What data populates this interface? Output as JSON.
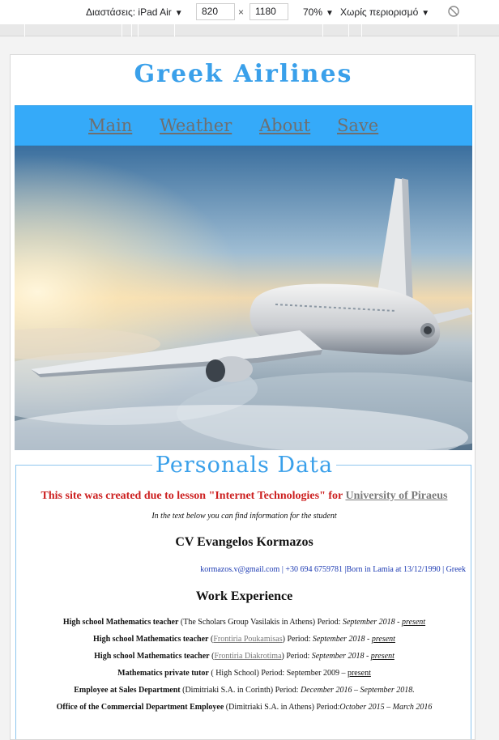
{
  "devtools": {
    "dimensions_label": "Διαστάσεις: iPad Air",
    "width": "820",
    "times": "×",
    "height": "1180",
    "zoom": "70%",
    "throttle": "Χωρίς περιορισμό"
  },
  "site": {
    "title": "Greek Airlines",
    "nav": [
      "Main",
      "Weather",
      "About",
      "Save"
    ]
  },
  "personals": {
    "heading": "Personals Data",
    "notice_text": "This site was created due to lesson \"Internet Technologies\" for ",
    "notice_link": "University of Piraeus",
    "intro": "In the text below you can find information for the student",
    "cv_title": "CV Evangelos Kormazos",
    "contact": "kormazos.v@gmail.com | +30 694 6759781 |Born in Lamia at 13/12/1990 | Greek",
    "work_title": "Work Experience",
    "jobs": [
      {
        "role": "High school Mathematics teacher",
        "pre": " (The Scholars Group Vasilakis in Athens) Period: ",
        "link": "",
        "post": "",
        "period": "September 2018 - ",
        "present": "present"
      },
      {
        "role": "High school Mathematics teacher",
        "pre": " (",
        "link": "Frontiria Poukamisas",
        "post": ") Period: ",
        "period": "September 2018 - ",
        "present": "present"
      },
      {
        "role": "High school Mathematics teacher",
        "pre": " (",
        "link": "Frontiria Diakrotima",
        "post": ") Period: ",
        "period": "September 2018 - ",
        "present": "present"
      },
      {
        "role": "Mathematics private tutor",
        "pre": " ( High School) Period: September 2009 – ",
        "link": "",
        "post": "",
        "period": "",
        "present": "present"
      },
      {
        "role": "Employee at Sales Department",
        "pre": " (Dimitriaki S.A. in Corinth) Period: ",
        "link": "",
        "post": "",
        "period": "December 2016 – September 2018.",
        "present": ""
      },
      {
        "role": "Office of the Commercial Department Employee",
        "pre": " (Dimitriaki S.A. in Athens) Period:",
        "link": "",
        "post": "",
        "period": "October 2015 – March 2016",
        "present": ""
      }
    ]
  },
  "colors": {
    "title": "#3aa0ea",
    "navbar": "#35aaf9",
    "notice": "#cc1f1f",
    "contact": "#1d3bb3"
  },
  "icons": {
    "rotate": "rotate-disabled-icon",
    "caret": "chevron-down-icon"
  }
}
